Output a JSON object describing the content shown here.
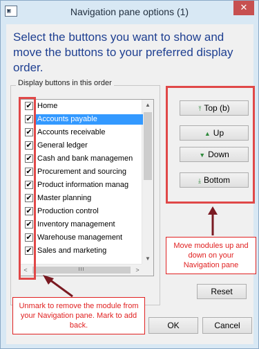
{
  "window": {
    "title": "Navigation pane options (1)",
    "close_glyph": "✕"
  },
  "instruction": "Select the buttons you want to show and move the buttons to your preferred display order.",
  "group_label": "Display buttons in this order",
  "modules": [
    {
      "label": "Home",
      "checked": true,
      "selected": false
    },
    {
      "label": "Accounts payable",
      "checked": true,
      "selected": true
    },
    {
      "label": "Accounts receivable",
      "checked": true,
      "selected": false
    },
    {
      "label": "General ledger",
      "checked": true,
      "selected": false
    },
    {
      "label": "Cash and bank managemen",
      "checked": true,
      "selected": false
    },
    {
      "label": "Procurement and sourcing",
      "checked": true,
      "selected": false
    },
    {
      "label": "Product information manag",
      "checked": true,
      "selected": false
    },
    {
      "label": "Master planning",
      "checked": true,
      "selected": false
    },
    {
      "label": "Production control",
      "checked": true,
      "selected": false
    },
    {
      "label": "Inventory management",
      "checked": true,
      "selected": false
    },
    {
      "label": "Warehouse management",
      "checked": true,
      "selected": false
    },
    {
      "label": "Sales and marketing",
      "checked": true,
      "selected": false
    }
  ],
  "buttons": {
    "top": "Top (b)",
    "up": "Up",
    "down": "Down",
    "bottom": "Bottom",
    "reset": "Reset",
    "ok": "OK",
    "cancel": "Cancel"
  },
  "icons": {
    "top": "top-arrow-icon",
    "up": "up-arrow-icon",
    "down": "down-arrow-icon",
    "bottom": "bottom-arrow-icon"
  },
  "annotations": {
    "move": "Move modules up and down on your Navigation pane",
    "unmark": "Unmark to remove the module from your Navigation pane. Mark to add back."
  },
  "colors": {
    "accent_red": "#e02020",
    "instruction_blue": "#1e3f91",
    "selection": "#3399ff"
  }
}
